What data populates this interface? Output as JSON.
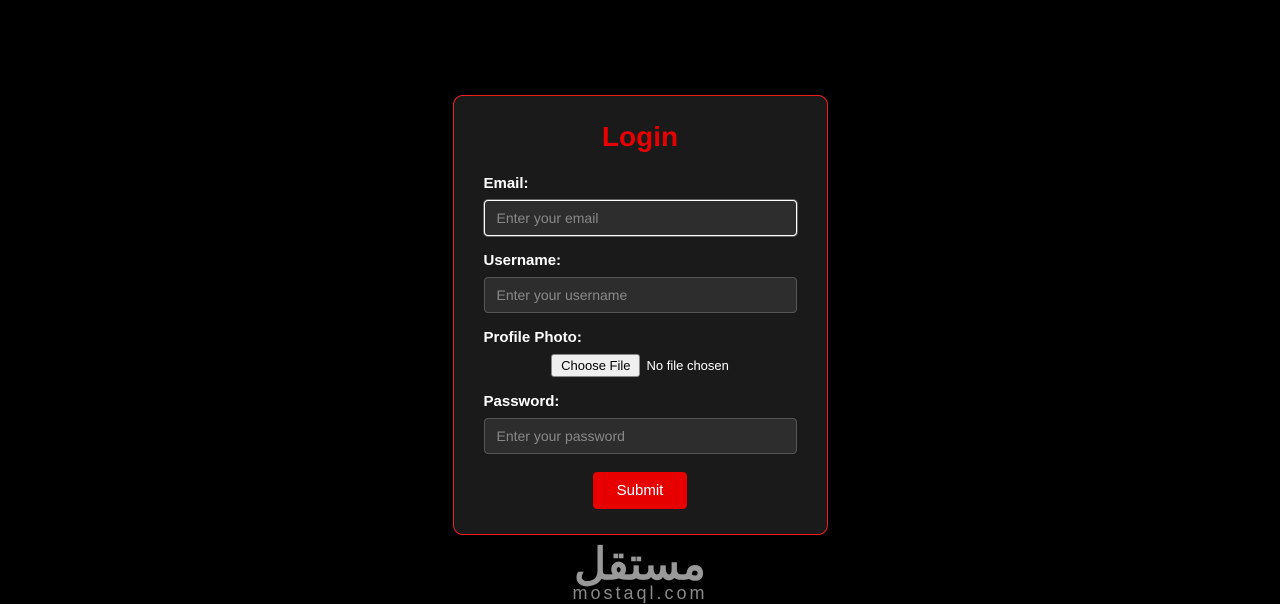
{
  "form": {
    "title": "Login",
    "email": {
      "label": "Email:",
      "placeholder": "Enter your email",
      "value": ""
    },
    "username": {
      "label": "Username:",
      "placeholder": "Enter your username",
      "value": ""
    },
    "photo": {
      "label": "Profile Photo:",
      "button_label": "Choose File",
      "status": "No file chosen"
    },
    "password": {
      "label": "Password:",
      "placeholder": "Enter your password",
      "value": ""
    },
    "submit_label": "Submit"
  },
  "watermark": {
    "arabic": "مستقل",
    "latin": "mostaql.com"
  }
}
